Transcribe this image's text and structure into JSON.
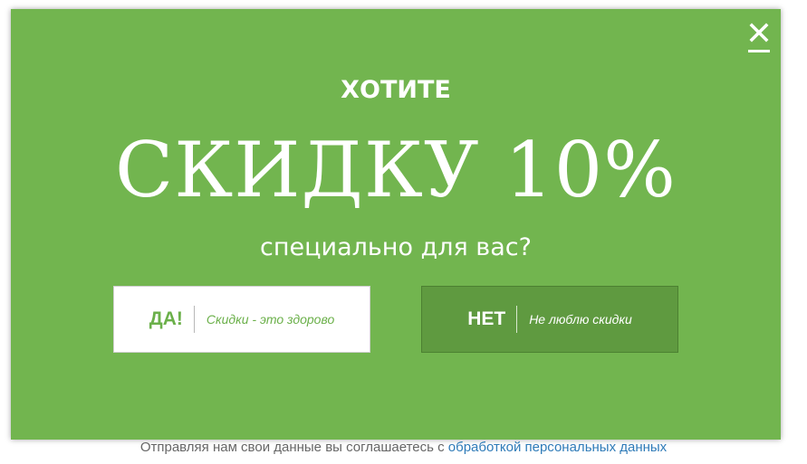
{
  "popup": {
    "close_icon": "close-x-icon",
    "heading_small": "ХОТИТЕ",
    "heading_big": "СКИДКУ 10%",
    "subtitle": "специально для вас?",
    "yes_button": {
      "main": "ДА!",
      "sub": "Скидки - это здорово"
    },
    "no_button": {
      "main": "НЕТ",
      "sub": "Не люблю скидки"
    },
    "colors": {
      "background": "#72b54f",
      "no_button": "#5f9a40",
      "text": "#ffffff"
    }
  },
  "consent": {
    "text": "Отправляя нам свои данные вы соглашаетесь с",
    "link": "обработкой персональных данных"
  }
}
